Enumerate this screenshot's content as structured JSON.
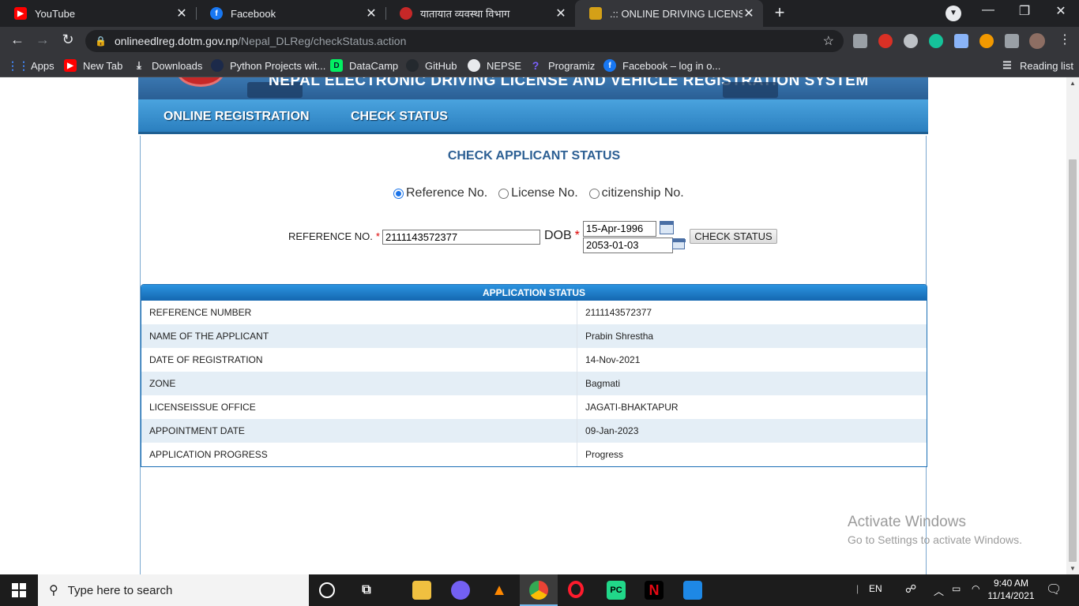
{
  "browser": {
    "tabs": [
      {
        "title": "YouTube",
        "favicon": "youtube-icon",
        "color": "#ff0000"
      },
      {
        "title": "Facebook",
        "favicon": "facebook-icon",
        "color": "#1877f2"
      },
      {
        "title": "यातायात व्यवस्था विभाग",
        "favicon": "nepal-emblem-icon",
        "color": "#c62828"
      },
      {
        "title": ".:: ONLINE DRIVING LICENSE ::.",
        "favicon": "nepal-flag-icon",
        "color": "#d4a017"
      }
    ],
    "url_host": "onlineedlreg.dotm.gov.np",
    "url_path": "/Nepal_DLReg/checkStatus.action",
    "bookmarks": [
      {
        "label": "Apps",
        "icon": "apps-grid-icon"
      },
      {
        "label": "New Tab",
        "icon": "youtube-icon"
      },
      {
        "label": "Downloads",
        "icon": "download-icon"
      },
      {
        "label": "Python Projects wit...",
        "icon": "python-icon"
      },
      {
        "label": "DataCamp",
        "icon": "datacamp-icon"
      },
      {
        "label": "GitHub",
        "icon": "github-icon"
      },
      {
        "label": "NEPSE",
        "icon": "nepse-icon"
      },
      {
        "label": "Programiz",
        "icon": "programiz-icon"
      },
      {
        "label": "Facebook – log in o...",
        "icon": "facebook-icon"
      }
    ],
    "reading_list": "Reading list"
  },
  "site": {
    "banner_heading": "NEPAL ELECTRONIC DRIVING LICENSE AND VEHICLE REGISTRATION SYSTEM",
    "nav": [
      "ONLINE REGISTRATION",
      "CHECK STATUS"
    ]
  },
  "form": {
    "title": "CHECK APPLICANT STATUS",
    "options": [
      "Reference No.",
      "License No.",
      "citizenship No."
    ],
    "selected_option": "Reference No.",
    "reference_label": "REFERENCE NO.",
    "reference_value": "2111143572377",
    "dob_label": "DOB",
    "dob_ad": "15-Apr-1996",
    "dob_bs": "2053-01-03",
    "button": "CHECK STATUS"
  },
  "status": {
    "header": "APPLICATION STATUS",
    "rows": [
      {
        "key": "REFERENCE NUMBER",
        "value": "2111143572377"
      },
      {
        "key": "NAME OF THE APPLICANT",
        "value": "Prabin Shrestha"
      },
      {
        "key": "DATE OF REGISTRATION",
        "value": "14-Nov-2021"
      },
      {
        "key": "ZONE",
        "value": "Bagmati"
      },
      {
        "key": "LICENSEISSUE OFFICE",
        "value": "JAGATI-BHAKTAPUR"
      },
      {
        "key": "APPOINTMENT DATE",
        "value": "09-Jan-2023"
      },
      {
        "key": "APPLICATION PROGRESS",
        "value": "Progress"
      }
    ]
  },
  "watermark": {
    "line1": "Activate Windows",
    "line2": "Go to Settings to activate Windows."
  },
  "taskbar": {
    "search_placeholder": "Type here to search",
    "language": "EN",
    "time": "9:40 AM",
    "date": "11/14/2021"
  }
}
